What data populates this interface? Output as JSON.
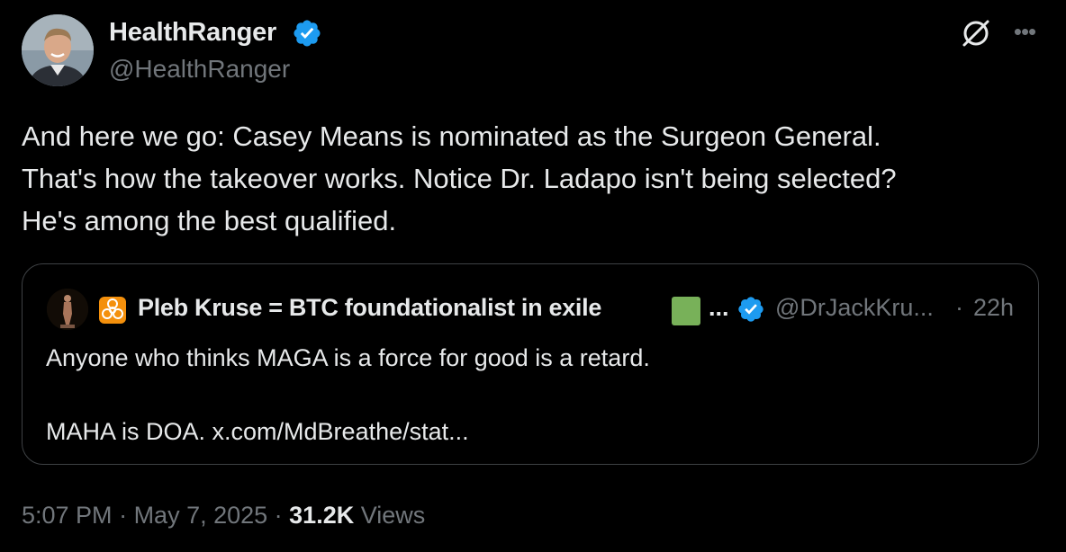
{
  "author": {
    "name": "HealthRanger",
    "handle": "@HealthRanger",
    "verified": true
  },
  "icons": {
    "grok": "grok-icon",
    "more": "more-icon",
    "verified": "verified-badge-icon",
    "biohazard": "biohazard-icon",
    "green_square": "green-square-icon"
  },
  "tweet": {
    "lines": [
      "And here we go: Casey Means is nominated as the Surgeon General.",
      "That's how the takeover works. Notice Dr. Ladapo isn't being selected?",
      "He's among the best qualified."
    ]
  },
  "quote": {
    "name": "Pleb Kruse = BTC foundationalist in exile",
    "ellipsis": "...",
    "handle": "@DrJackKru...",
    "separator": "·",
    "time": "22h",
    "lines": [
      "Anyone who thinks MAGA is a force for good is a retard.",
      "",
      "MAHA is DOA. x.com/MdBreathe/stat..."
    ]
  },
  "meta": {
    "time": "5:07 PM",
    "sep1": " · ",
    "date": "May 7, 2025",
    "sep2": " · ",
    "views_count": "31.2K",
    "views_label": " Views"
  },
  "colors": {
    "background": "#000000",
    "text": "#e7e9ea",
    "secondary": "#71767b",
    "verified": "#1d9bf0",
    "border": "#3e4144"
  }
}
